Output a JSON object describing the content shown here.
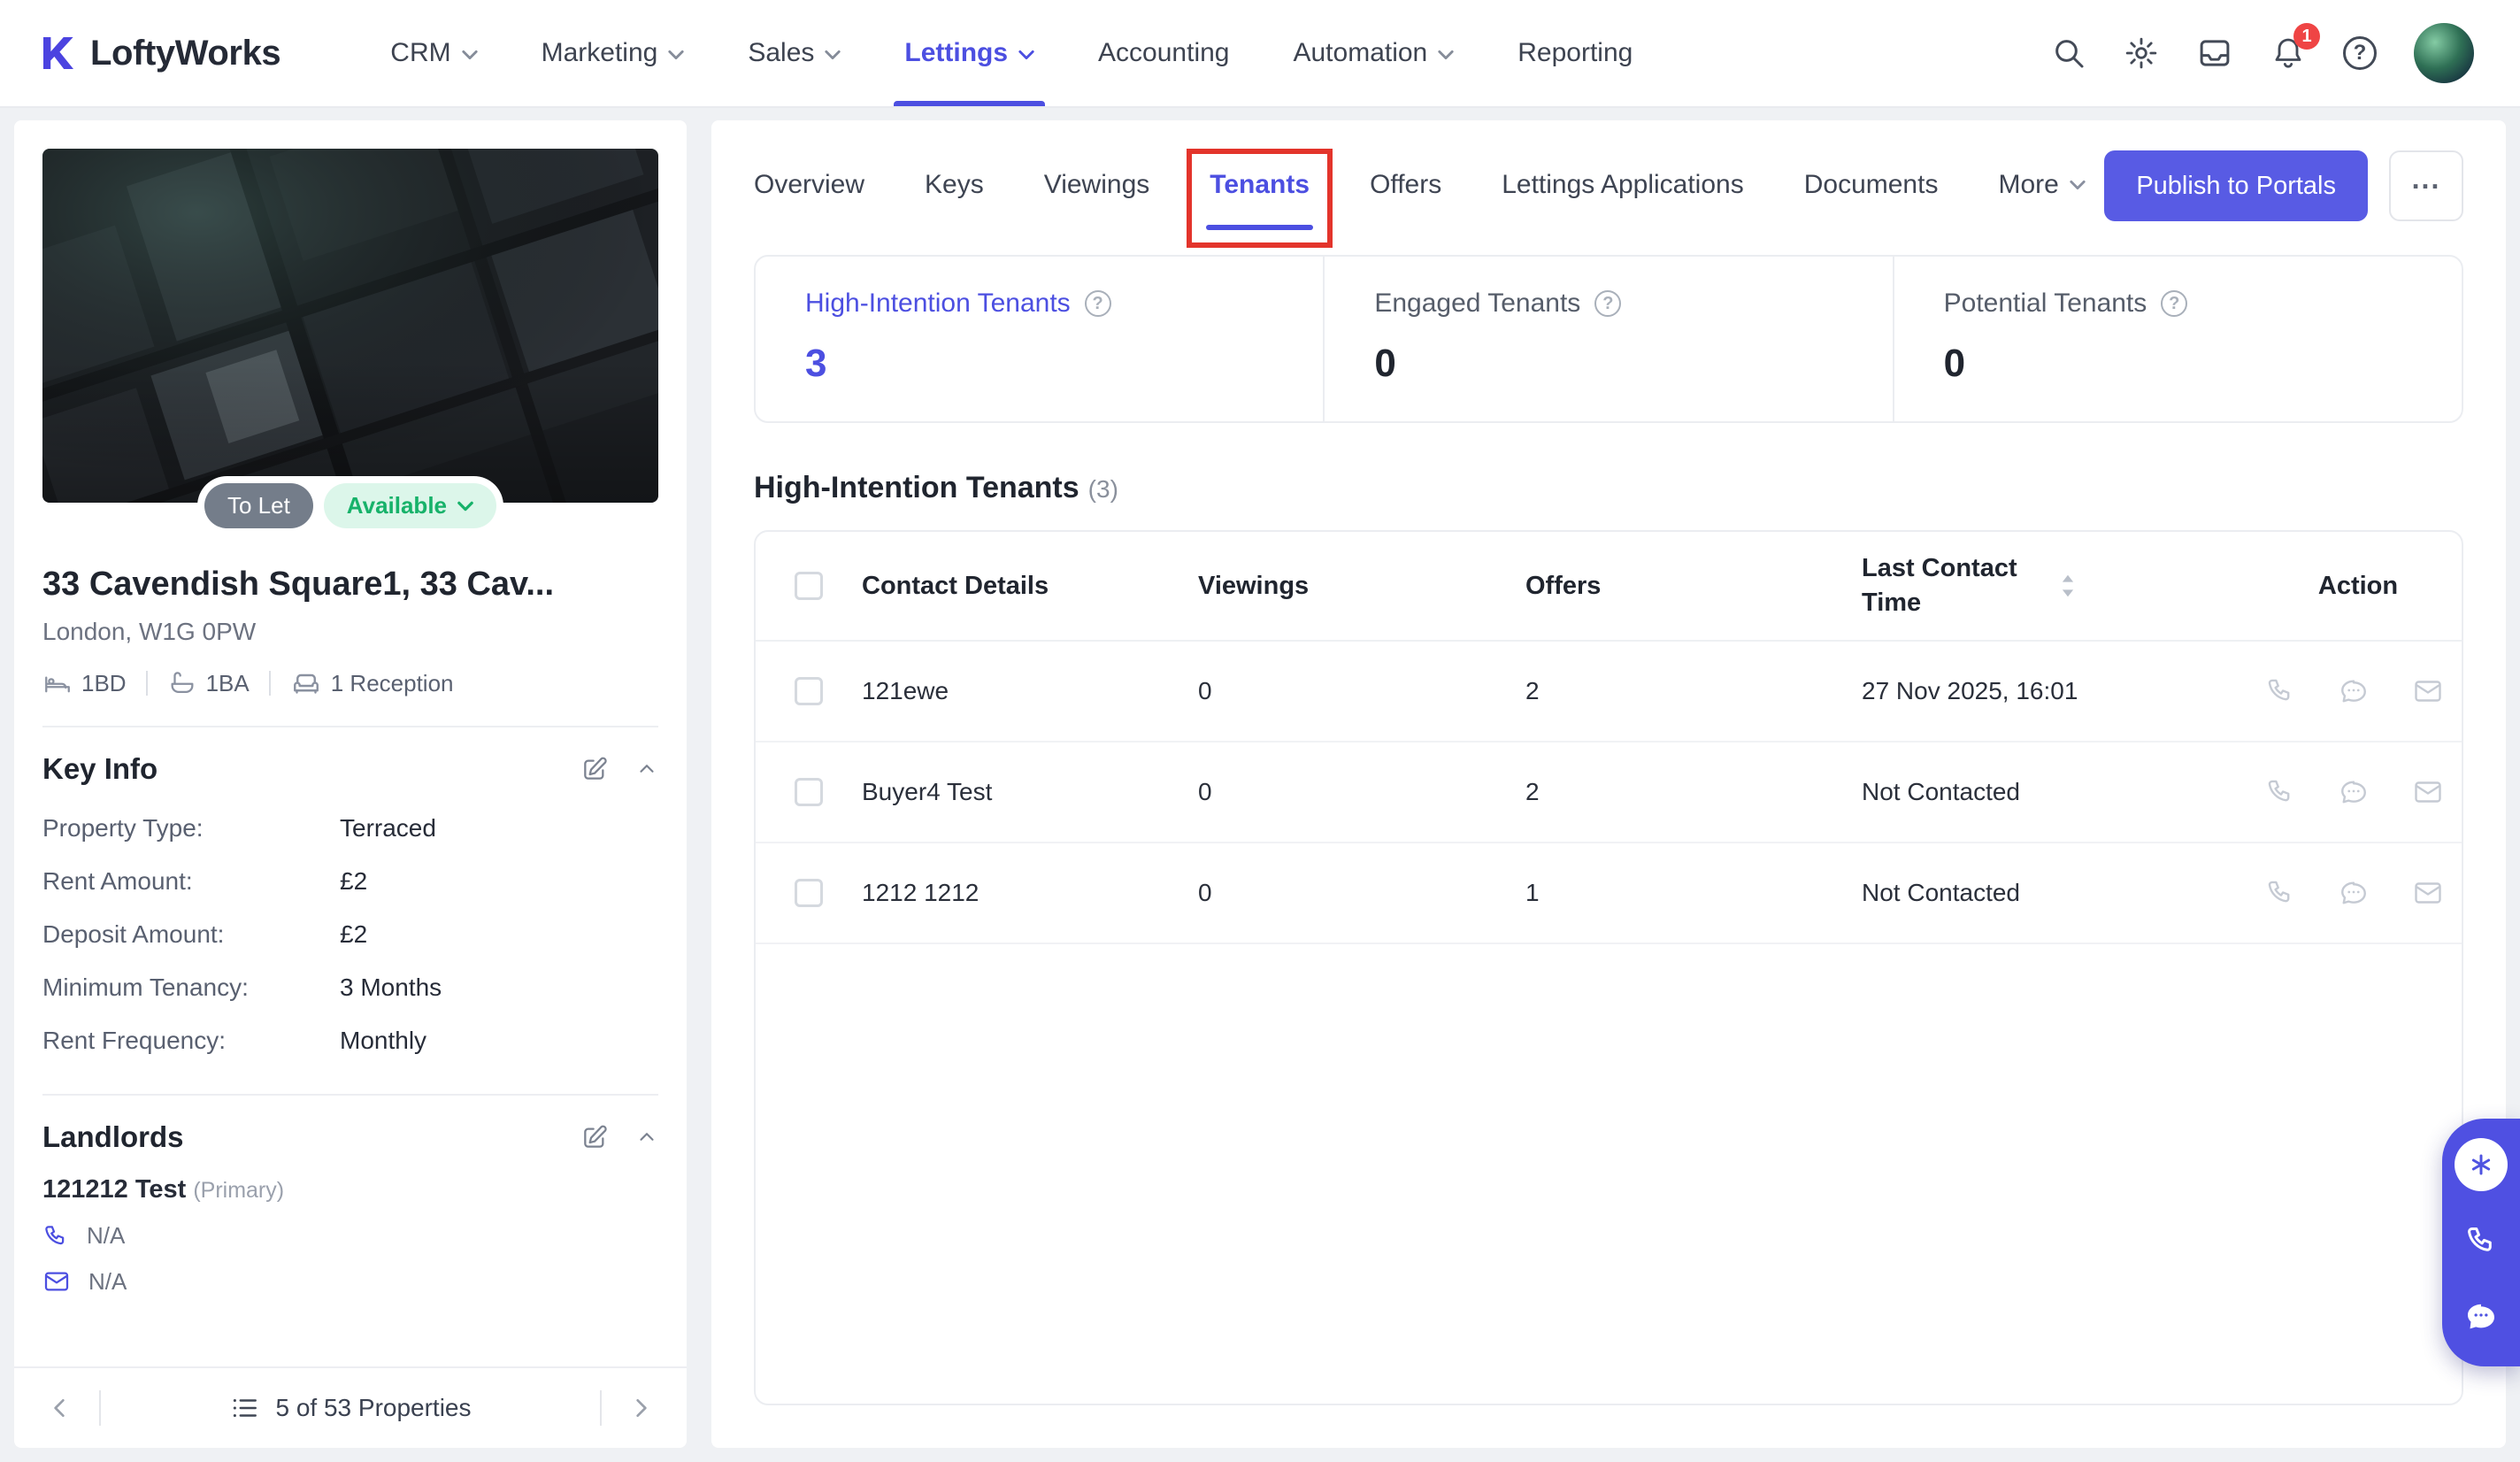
{
  "brand": {
    "name": "LoftyWorks"
  },
  "navbar": {
    "items": [
      {
        "label": "CRM",
        "dropdown": true
      },
      {
        "label": "Marketing",
        "dropdown": true
      },
      {
        "label": "Sales",
        "dropdown": true
      },
      {
        "label": "Lettings",
        "dropdown": true,
        "active": true
      },
      {
        "label": "Accounting",
        "dropdown": false
      },
      {
        "label": "Automation",
        "dropdown": true
      },
      {
        "label": "Reporting",
        "dropdown": false
      }
    ],
    "notification_badge": "1"
  },
  "glyphs": {
    "help": "?",
    "ellipsis": "..."
  },
  "property": {
    "badges": {
      "to_let": "To Let",
      "availability": "Available"
    },
    "title": "33 Cavendish Square1, 33 Cav...",
    "address": "London, W1G 0PW",
    "amenities": [
      {
        "icon": "bed-icon",
        "label": "1BD"
      },
      {
        "icon": "bath-icon",
        "label": "1BA"
      },
      {
        "icon": "sofa-icon",
        "label": "1 Reception"
      }
    ],
    "key_info": {
      "heading": "Key Info",
      "rows": [
        {
          "label": "Property Type:",
          "value": "Terraced"
        },
        {
          "label": "Rent Amount:",
          "value": "£2"
        },
        {
          "label": "Deposit Amount:",
          "value": "£2"
        },
        {
          "label": "Minimum Tenancy:",
          "value": "3 Months"
        },
        {
          "label": "Rent Frequency:",
          "value": "Monthly"
        }
      ]
    },
    "landlords": {
      "heading": "Landlords",
      "name": "121212 Test",
      "tag": "(Primary)",
      "phone": "N/A",
      "email": "N/A"
    },
    "pagination": {
      "label": "5 of 53 Properties"
    }
  },
  "tabs": [
    {
      "label": "Overview"
    },
    {
      "label": "Keys"
    },
    {
      "label": "Viewings"
    },
    {
      "label": "Tenants",
      "active": true,
      "annotated": true
    },
    {
      "label": "Offers"
    },
    {
      "label": "Lettings Applications"
    },
    {
      "label": "Documents"
    },
    {
      "label": "More",
      "dropdown": true
    }
  ],
  "actions": {
    "publish_label": "Publish to Portals",
    "more_label": "..."
  },
  "stats": [
    {
      "label": "High-Intention Tenants",
      "value": "3",
      "highlight": true
    },
    {
      "label": "Engaged Tenants",
      "value": "0"
    },
    {
      "label": "Potential Tenants",
      "value": "0"
    }
  ],
  "tenant_table": {
    "title": "High-Intention Tenants",
    "count": "(3)",
    "columns": [
      "Contact Details",
      "Viewings",
      "Offers",
      "Last Contact Time",
      "Action"
    ],
    "rows": [
      {
        "contact": "121ewe",
        "viewings": "0",
        "offers": "2",
        "last_contact": "27 Nov 2025, 16:01"
      },
      {
        "contact": "Buyer4 Test",
        "viewings": "0",
        "offers": "2",
        "last_contact": "Not Contacted"
      },
      {
        "contact": "1212 1212",
        "viewings": "0",
        "offers": "1",
        "last_contact": "Not Contacted"
      }
    ]
  },
  "colors": {
    "primary": "#4c4fe1",
    "green": "#17b26a",
    "annotation_red": "#e3342b",
    "badge_red": "#ef4444"
  }
}
